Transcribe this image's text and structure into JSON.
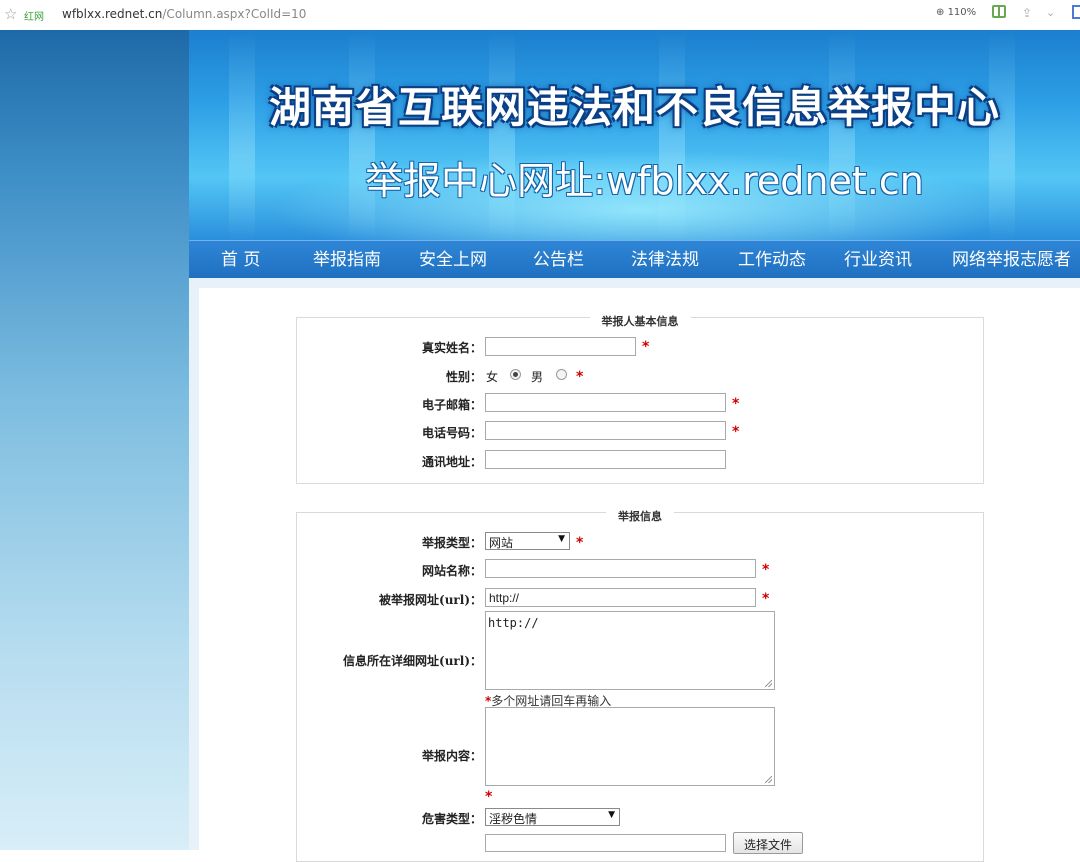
{
  "browser": {
    "site_label": "红网",
    "url_host": "wfblxx.rednet.cn",
    "url_path": "/Column.aspx?ColId=10",
    "zoom": "110%"
  },
  "banner": {
    "title": "湖南省互联网违法和不良信息举报中心",
    "subtitle": "举报中心网址:wfblxx.rednet.cn"
  },
  "nav": {
    "items": [
      "首 页",
      "举报指南",
      "安全上网",
      "公告栏",
      "法律法规",
      "工作动态",
      "行业资讯",
      "网络举报志愿者"
    ]
  },
  "reporter_section": {
    "legend": "举报人基本信息",
    "name_label": "真实姓名：",
    "gender_label": "性别：",
    "gender_female": "女",
    "gender_male": "男",
    "gender_selected": "female",
    "email_label": "电子邮箱：",
    "phone_label": "电话号码：",
    "address_label": "通讯地址："
  },
  "report_section": {
    "legend": "举报信息",
    "type_label": "举报类型：",
    "type_value": "网站",
    "site_name_label": "网站名称：",
    "url_label": "被举报网址(url)：",
    "url_value": "http://",
    "detail_url_label": "信息所在详细网址(url)：",
    "detail_url_value": "http://",
    "detail_url_hint": "多个网址请回车再输入",
    "content_label": "举报内容：",
    "harm_type_label": "危害类型：",
    "harm_type_value": "淫秽色情",
    "file_button": "选择文件"
  },
  "required_mark": "*",
  "colors": {
    "required": "#d10000",
    "nav_bg": "#1f6fc0",
    "banner_bg": "#2d9fe6"
  }
}
